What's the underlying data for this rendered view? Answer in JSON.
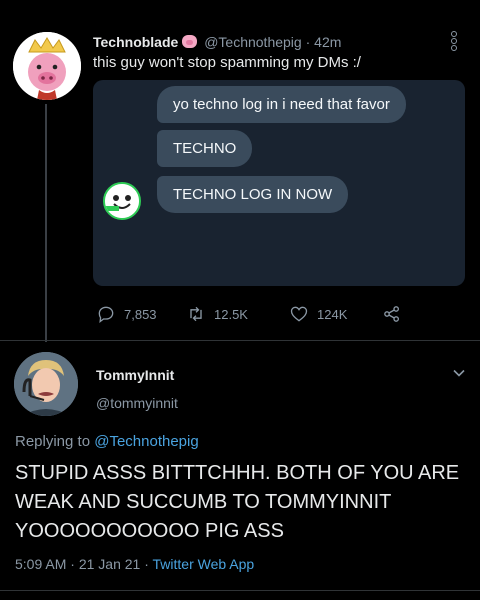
{
  "tweet": {
    "author_name": "Technoblade",
    "author_emoji": "pig-icon",
    "handle": "@Technothepig",
    "separator": "·",
    "time": "42m",
    "text": "this guy won't stop spamming my DMs :/",
    "dm_messages": [
      "yo techno log in i need that favor",
      "TECHNO",
      "TECHNO LOG IN NOW"
    ],
    "stats": {
      "replies": "7,853",
      "retweets": "12.5K",
      "likes": "124K"
    }
  },
  "reply": {
    "author_name": "TommyInnit",
    "handle": "@tommyinnit",
    "replying_label": "Replying to",
    "replying_to": "@Technothepig",
    "text": "STUPID ASSS BITTTCHHH. BOTH OF YOU ARE WEAK AND SUCCUMB TO TOMMYINNIT YOOOOOOOOOOO PIG ASS",
    "time": "5:09 AM",
    "date": "21 Jan 21",
    "dot": "·",
    "source": "Twitter Web App"
  },
  "colors": {
    "background": "#000000",
    "dm_card": "#192330",
    "bubble": "#3a4b5c",
    "link": "#4aa3df",
    "muted": "#8b98a5",
    "dm_avatar_ring": "#2ecc55"
  }
}
